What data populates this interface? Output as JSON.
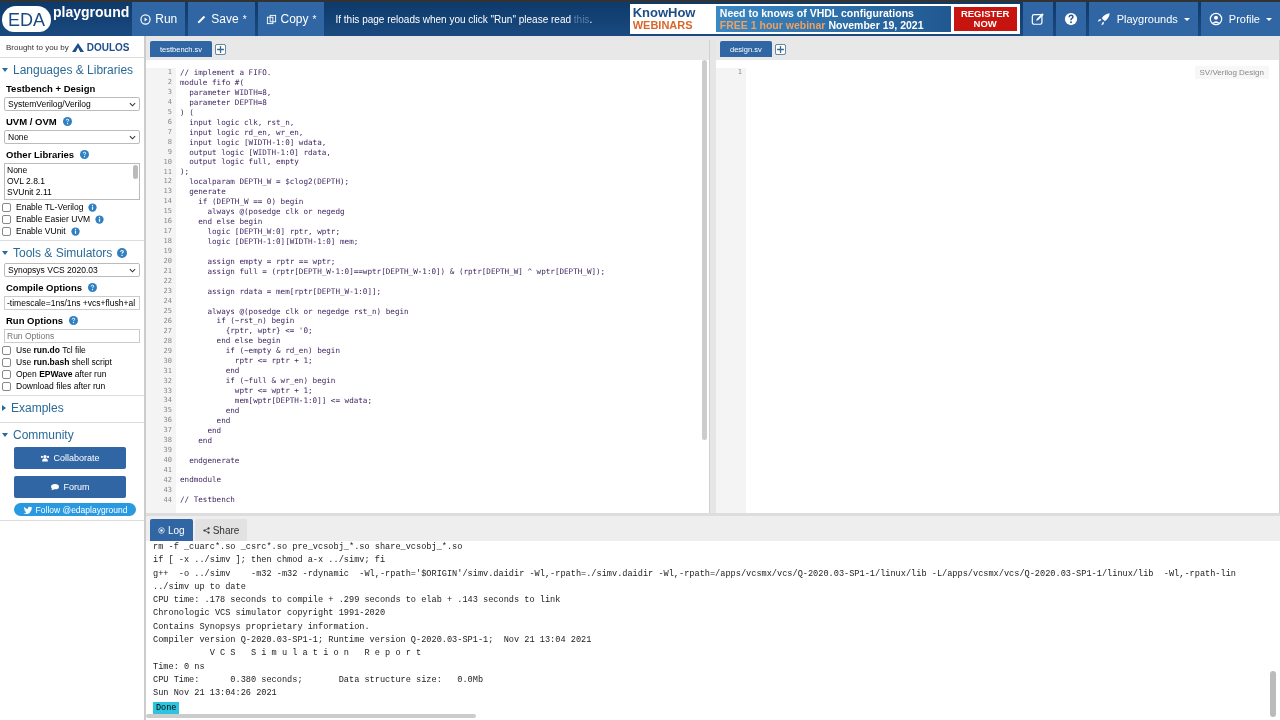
{
  "header": {
    "logo": {
      "badge": "EDA",
      "name": "playground"
    },
    "buttons": [
      {
        "kind": "run",
        "label": "Run"
      },
      {
        "kind": "save",
        "label": "Save",
        "mark": "*"
      },
      {
        "kind": "copy",
        "label": "Copy",
        "mark": "*"
      }
    ],
    "notice": {
      "text": "If this page reloads when you click \"Run\" please read",
      "link": "this",
      "end": "."
    },
    "ad": {
      "brand": "KnowHow",
      "sub": "WEBINARS",
      "headline": "Need to knows of VHDL configurations",
      "offer": "FREE 1 hour webinar",
      "date": "November 19, 2021",
      "cta": "REGISTER NOW"
    },
    "nav": [
      {
        "kind": "edit"
      },
      {
        "kind": "help"
      },
      {
        "kind": "rocket",
        "label": "Playgrounds"
      },
      {
        "kind": "user",
        "label": "Profile"
      }
    ]
  },
  "sidebar": {
    "brought": "Brought to you by",
    "sponsor": "DOULOS",
    "sections": [
      {
        "title": "Languages & Libraries",
        "expanded": true,
        "help": false,
        "items": [
          {
            "kind": "label",
            "label": "Testbench + Design",
            "help": false
          },
          {
            "kind": "select",
            "value": "SystemVerilog/Verilog"
          },
          {
            "kind": "label",
            "label": "UVM / OVM",
            "help": true
          },
          {
            "kind": "select",
            "value": "None"
          },
          {
            "kind": "label",
            "label": "Other Libraries",
            "help": true
          },
          {
            "kind": "listbox",
            "options": [
              "None",
              "OVL 2.8.1",
              "SVUnit 2.11"
            ]
          },
          {
            "kind": "checkbox",
            "text": "Enable TL-Verilog",
            "checked": false,
            "info": true
          },
          {
            "kind": "checkbox",
            "text": "Enable Easier UVM",
            "checked": false,
            "info": true
          },
          {
            "kind": "checkbox",
            "text": "Enable VUnit",
            "checked": false,
            "info": true
          }
        ]
      },
      {
        "title": "Tools & Simulators",
        "expanded": true,
        "help": true,
        "items": [
          {
            "kind": "select",
            "value": "Synopsys VCS 2020.03"
          },
          {
            "kind": "label",
            "label": "Compile Options",
            "help": true
          },
          {
            "kind": "input",
            "value": "-timescale=1ns/1ns +vcs+flush+al"
          },
          {
            "kind": "label",
            "label": "Run Options",
            "help": true
          },
          {
            "kind": "input",
            "placeholder": "Run Options"
          },
          {
            "kind": "checkbox",
            "text": "Use **run.do** Tcl file",
            "checked": false,
            "info": false
          },
          {
            "kind": "checkbox",
            "text": "Use **run.bash** shell script",
            "checked": false,
            "info": false
          },
          {
            "kind": "checkbox",
            "text": "Open **EPWave** after run",
            "checked": false,
            "info": false
          },
          {
            "kind": "checkbox",
            "text": "Download files after run",
            "checked": false,
            "info": false
          }
        ]
      },
      {
        "title": "Examples",
        "expanded": false,
        "help": false
      },
      {
        "title": "Community",
        "expanded": true,
        "help": false,
        "items": [
          {
            "kind": "button",
            "text": "Collaborate"
          },
          {
            "kind": "button",
            "text": "Forum"
          },
          {
            "kind": "pill",
            "text": "Follow @edaplayground"
          }
        ]
      }
    ]
  },
  "editors": [
    {
      "tabs": [
        {
          "label": "testbench.sv",
          "selected": true
        }
      ],
      "lines": [
        {
          "n": "1",
          "text": "// implement a FIFO."
        },
        {
          "n": "2",
          "text": "module fifo #("
        },
        {
          "n": "3",
          "text": "  parameter WIDTH=8,"
        },
        {
          "n": "4",
          "text": "  parameter DEPTH=8"
        },
        {
          "n": "5",
          "text": ") ("
        },
        {
          "n": "6",
          "text": "  input logic clk, rst_n,"
        },
        {
          "n": "7",
          "text": "  input logic rd_en, wr_en,"
        },
        {
          "n": "8",
          "text": "  input logic [WIDTH-1:0] wdata,"
        },
        {
          "n": "9",
          "text": "  output logic [WIDTH-1:0] rdata,"
        },
        {
          "n": "10",
          "text": "  output logic full, empty"
        },
        {
          "n": "11",
          "text": ");"
        },
        {
          "n": "12",
          "text": "  localparam DEPTH_W = $clog2(DEPTH);"
        },
        {
          "n": "13",
          "text": "  generate"
        },
        {
          "n": "14",
          "text": "    if (DEPTH_W == 0) begin"
        },
        {
          "n": "15",
          "text": "      always @(posedge clk or negedg"
        },
        {
          "n": "16",
          "text": "    end else begin"
        },
        {
          "n": "17",
          "text": "      logic [DEPTH_W:0] rptr, wptr;"
        },
        {
          "n": "18",
          "text": "      logic [DEPTH-1:0][WIDTH-1:0] mem;"
        },
        {
          "n": "19"
        },
        {
          "n": "20",
          "text": "      assign empty = rptr == wptr;"
        },
        {
          "n": "21",
          "text": "      assign full = (rptr[DEPTH_W-1:0]==wptr[DEPTH_W-1:0]) & (rptr[DEPTH_W] ^ wptr[DEPTH_W]);"
        },
        {
          "n": "22"
        },
        {
          "n": "23",
          "text": "      assign rdata = mem[rptr[DEPTH_W-1:0]];"
        },
        {
          "n": "24"
        },
        {
          "n": "25",
          "text": "      always @(posedge clk or negedge rst_n) begin"
        },
        {
          "n": "26",
          "text": "        if (~rst_n) begin"
        },
        {
          "n": "27",
          "text": "          {rptr, wptr} <= '0;"
        },
        {
          "n": "28",
          "text": "        end else begin"
        },
        {
          "n": "29",
          "text": "          if (~empty & rd_en) begin"
        },
        {
          "n": "30",
          "text": "            rptr <= rptr + 1;"
        },
        {
          "n": "31",
          "text": "          end"
        },
        {
          "n": "32",
          "text": "          if (~full & wr_en) begin"
        },
        {
          "n": "33",
          "text": "            wptr <= wptr + 1;"
        },
        {
          "n": "34",
          "text": "            mem[wptr[DEPTH-1:0]] <= wdata;"
        },
        {
          "n": "35",
          "text": "          end"
        },
        {
          "n": "36",
          "text": "        end"
        },
        {
          "n": "37",
          "text": "      end"
        },
        {
          "n": "38",
          "text": "    end"
        },
        {
          "n": "39"
        },
        {
          "n": "40",
          "text": "  endgenerate"
        },
        {
          "n": "41"
        },
        {
          "n": "42",
          "text": "endmodule"
        },
        {
          "n": "43"
        },
        {
          "n": "44",
          "text": "// Testbench"
        }
      ]
    },
    {
      "tabs": [
        {
          "label": "design.sv",
          "selected": true
        }
      ],
      "caption": "SV/Verilog Design",
      "lines": [
        {
          "n": "1"
        }
      ]
    }
  ],
  "log": {
    "tabs": [
      {
        "label": "Log",
        "selected": true
      },
      {
        "label": "Share",
        "selected": false
      }
    ],
    "lines": [
      "rm -f _cuarc*.so _csrc*.so pre_vcsobj_*.so share_vcsobj_*.so",
      "if [ -x ../simv ]; then chmod a-x ../simv; fi",
      "g++  -o ../simv    -m32 -m32 -rdynamic  -Wl,-rpath='$ORIGIN'/simv.daidir -Wl,-rpath=./simv.daidir -Wl,-rpath=/apps/vcsmx/vcs/Q-2020.03-SP1-1/linux/lib -L/apps/vcsmx/vcs/Q-2020.03-SP1-1/linux/lib  -Wl,-rpath-lin",
      "../simv up to date",
      "CPU time: .178 seconds to compile + .299 seconds to elab + .143 seconds to link",
      "Chronologic VCS simulator copyright 1991-2020",
      "Contains Synopsys proprietary information.",
      "Compiler version Q-2020.03-SP1-1; Runtime version Q-2020.03-SP1-1;  Nov 21 13:04 2021",
      "           V C S   S i m u l a t i o n   R e p o r t",
      "Time: 0 ns",
      "CPU Time:      0.380 seconds;       Data structure size:   0.0Mb",
      "Sun Nov 21 13:04:26 2021"
    ],
    "status": "Done"
  }
}
